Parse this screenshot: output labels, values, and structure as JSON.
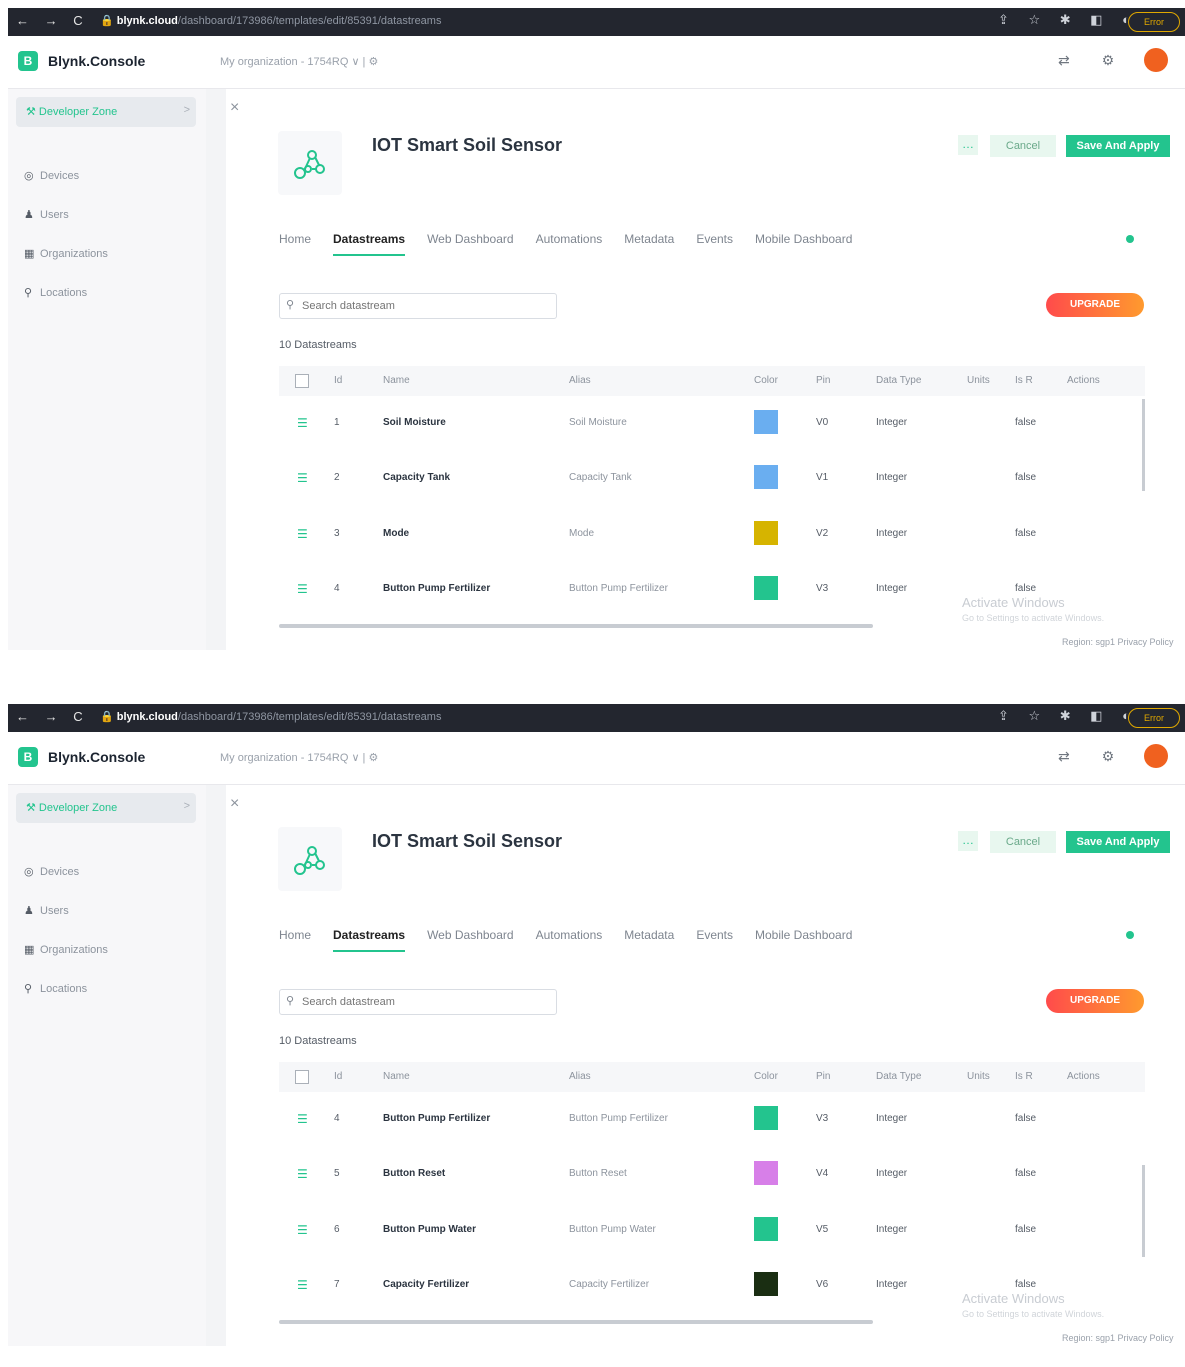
{
  "browser": {
    "nav": "← → C",
    "host": "blynk.cloud",
    "path": "/dashboard/173986/templates/edit/85391/datastreams",
    "icons": "⇪ ☆ ✱ ◧ ◐",
    "ext_label": "Error"
  },
  "app": {
    "logo_letter": "B",
    "brand": "Blynk.Console",
    "org": "My organization - 1754RQ ∨  |  ⚙",
    "header_icons": "⇄ ⚙ ⌂"
  },
  "sidebar": {
    "developer_zone": "Developer Zone",
    "chev": ">",
    "items": [
      {
        "icon": "◎",
        "label": "Devices"
      },
      {
        "icon": "♟",
        "label": "Users"
      },
      {
        "icon": "▦",
        "label": "Organizations"
      },
      {
        "icon": "⚲",
        "label": "Locations"
      }
    ]
  },
  "template": {
    "title": "IOT Smart Soil Sensor",
    "more_label": "…",
    "cancel_label": "Cancel",
    "save_label": "Save And Apply"
  },
  "tabs": [
    "Home",
    "Datastreams",
    "Web Dashboard",
    "Automations",
    "Metadata",
    "Events",
    "Mobile Dashboard"
  ],
  "active_tab": "Datastreams",
  "search": {
    "placeholder": "Search datastream"
  },
  "upgrade_label": "UPGRADE",
  "count_label": "10 Datastreams",
  "columns": [
    "Id",
    "Name",
    "Alias",
    "Color",
    "Pin",
    "Data Type",
    "Units",
    "Is R",
    "Actions"
  ],
  "colors": {
    "accent": "#23c48e",
    "upgrade_start": "#ff4b4b",
    "upgrade_end": "#ff9a2e"
  },
  "views": [
    {
      "rows": [
        {
          "id": "1",
          "name": "Soil Moisture",
          "alias": "Soil Moisture",
          "color": "#6aaef0",
          "pin": "V0",
          "type": "Integer",
          "raw": "false"
        },
        {
          "id": "2",
          "name": "Capacity Tank",
          "alias": "Capacity Tank",
          "color": "#6aaef0",
          "pin": "V1",
          "type": "Integer",
          "raw": "false"
        },
        {
          "id": "3",
          "name": "Mode",
          "alias": "Mode",
          "color": "#d6b400",
          "pin": "V2",
          "type": "Integer",
          "raw": "false"
        },
        {
          "id": "4",
          "name": "Button Pump Fertilizer",
          "alias": "Button Pump Fertilizer",
          "color": "#23c48e",
          "pin": "V3",
          "type": "Integer",
          "raw": "false"
        }
      ]
    },
    {
      "rows": [
        {
          "id": "4",
          "name": "Button Pump Fertilizer",
          "alias": "Button Pump Fertilizer",
          "color": "#23c48e",
          "pin": "V3",
          "type": "Integer",
          "raw": "false"
        },
        {
          "id": "5",
          "name": "Button Reset",
          "alias": "Button Reset",
          "color": "#d77fe8",
          "pin": "V4",
          "type": "Integer",
          "raw": "false"
        },
        {
          "id": "6",
          "name": "Button Pump Water",
          "alias": "Button Pump Water",
          "color": "#23c48e",
          "pin": "V5",
          "type": "Integer",
          "raw": "false"
        },
        {
          "id": "7",
          "name": "Capacity Fertilizer",
          "alias": "Capacity Fertilizer",
          "color": "#1a2e12",
          "pin": "V6",
          "type": "Integer",
          "raw": "false"
        }
      ]
    }
  ],
  "watermark": {
    "title": "Activate Windows",
    "subtitle": "Go to Settings to activate Windows."
  },
  "footer": "Region: sgp1   Privacy Policy"
}
